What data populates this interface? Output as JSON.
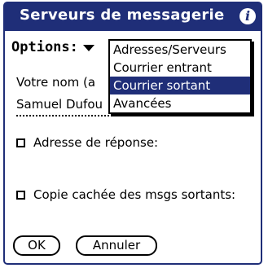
{
  "dialog": {
    "title": "Serveurs de messagerie",
    "info_icon": "i",
    "info_icon_name": "info-icon"
  },
  "options": {
    "label": "Options:",
    "menu_items": [
      "Adresses/Serveurs",
      "Courrier entrant",
      "Courrier sortant",
      "Avancées"
    ],
    "selected_item": "Courrier sortant"
  },
  "form": {
    "name_label": "Votre nom (a",
    "name_value": "Samuel Dufou",
    "reply_address_label": "Adresse de réponse:",
    "bcc_label": "Copie cachée des msgs sortants:"
  },
  "buttons": {
    "ok": "OK",
    "cancel": "Annuler"
  },
  "colors": {
    "accent": "#1f2e78"
  }
}
